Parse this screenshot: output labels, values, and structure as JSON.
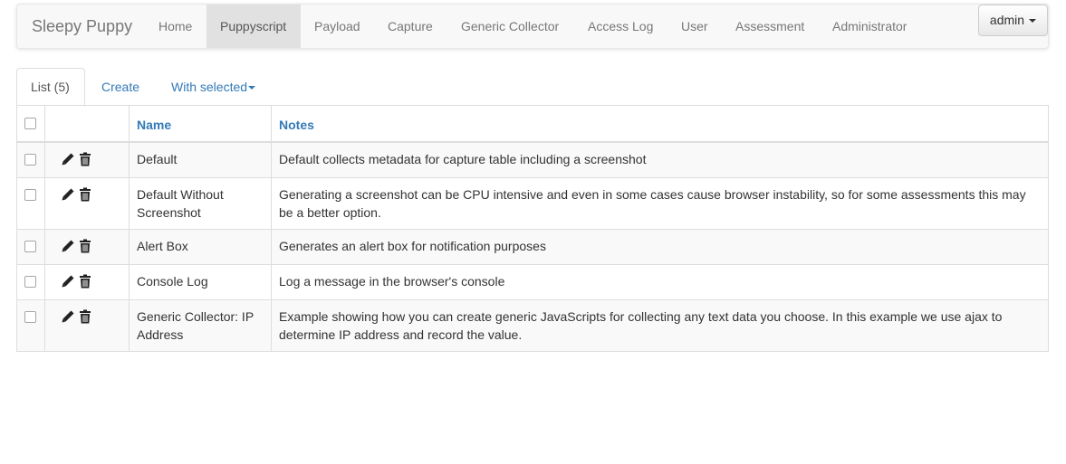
{
  "navbar": {
    "brand": "Sleepy Puppy",
    "items": [
      {
        "label": "Home",
        "active": false
      },
      {
        "label": "Puppyscript",
        "active": true
      },
      {
        "label": "Payload",
        "active": false
      },
      {
        "label": "Capture",
        "active": false
      },
      {
        "label": "Generic Collector",
        "active": false
      },
      {
        "label": "Access Log",
        "active": false
      },
      {
        "label": "User",
        "active": false
      },
      {
        "label": "Assessment",
        "active": false
      },
      {
        "label": "Administrator",
        "active": false
      }
    ],
    "user_menu": {
      "label": "admin",
      "icon": "caret-down-icon"
    }
  },
  "tabs": {
    "list_label": "List (5)",
    "create_label": "Create",
    "with_selected_label": "With selected",
    "with_selected_icon": "caret-down-icon"
  },
  "table": {
    "columns": {
      "name": "Name",
      "notes": "Notes"
    },
    "row_icons": [
      "pencil-icon",
      "trash-icon"
    ],
    "rows": [
      {
        "name": "Default",
        "notes": "Default collects metadata for capture table including a screenshot"
      },
      {
        "name": "Default Without Screenshot",
        "notes": "Generating a screenshot can be CPU intensive and even in some cases cause browser instability, so for some assessments this may be a better option."
      },
      {
        "name": "Alert Box",
        "notes": "Generates an alert box for notification purposes"
      },
      {
        "name": "Console Log",
        "notes": "Log a message in the browser's console"
      },
      {
        "name": "Generic Collector: IP Address",
        "notes": "Example showing how you can create generic JavaScripts for collecting any text data you choose. In this example we use ajax to determine IP address and record the value."
      }
    ]
  },
  "colors": {
    "link": "#337ab7",
    "navbar_bg": "#f8f8f8",
    "nav_active_bg": "#e1e1e1",
    "row_stripe": "#f9f9f9",
    "border": "#dddddd"
  }
}
